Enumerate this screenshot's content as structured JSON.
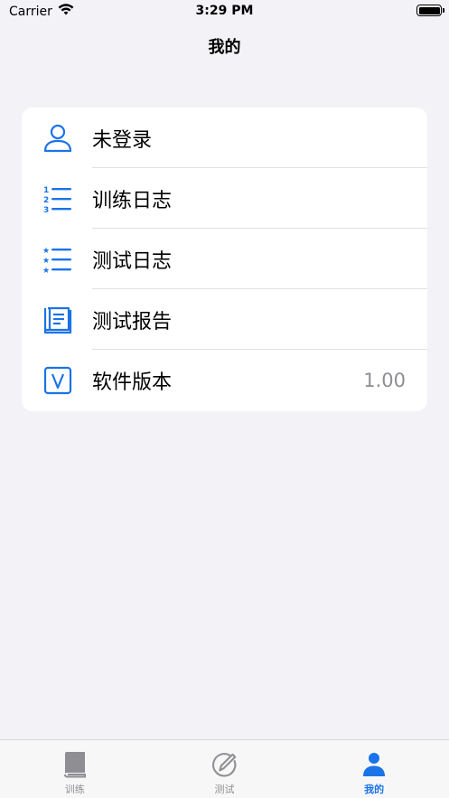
{
  "status_bar": {
    "carrier": "Carrier",
    "time": "3:29 PM"
  },
  "nav": {
    "title": "我的"
  },
  "menu": {
    "items": [
      {
        "label": "未登录",
        "icon": "person-icon"
      },
      {
        "label": "训练日志",
        "icon": "numbered-list-icon"
      },
      {
        "label": "测试日志",
        "icon": "starred-list-icon"
      },
      {
        "label": "测试报告",
        "icon": "report-book-icon"
      },
      {
        "label": "软件版本",
        "icon": "version-v-icon",
        "value": "1.00"
      }
    ]
  },
  "tabbar": {
    "tabs": [
      {
        "label": "训练",
        "icon": "book-icon",
        "active": false
      },
      {
        "label": "测试",
        "icon": "compass-pencil-icon",
        "active": false
      },
      {
        "label": "我的",
        "icon": "person-fill-icon",
        "active": true
      }
    ]
  },
  "colors": {
    "accent": "#1a73e8",
    "background": "#f2f2f7",
    "inactive": "#8e8e93"
  }
}
